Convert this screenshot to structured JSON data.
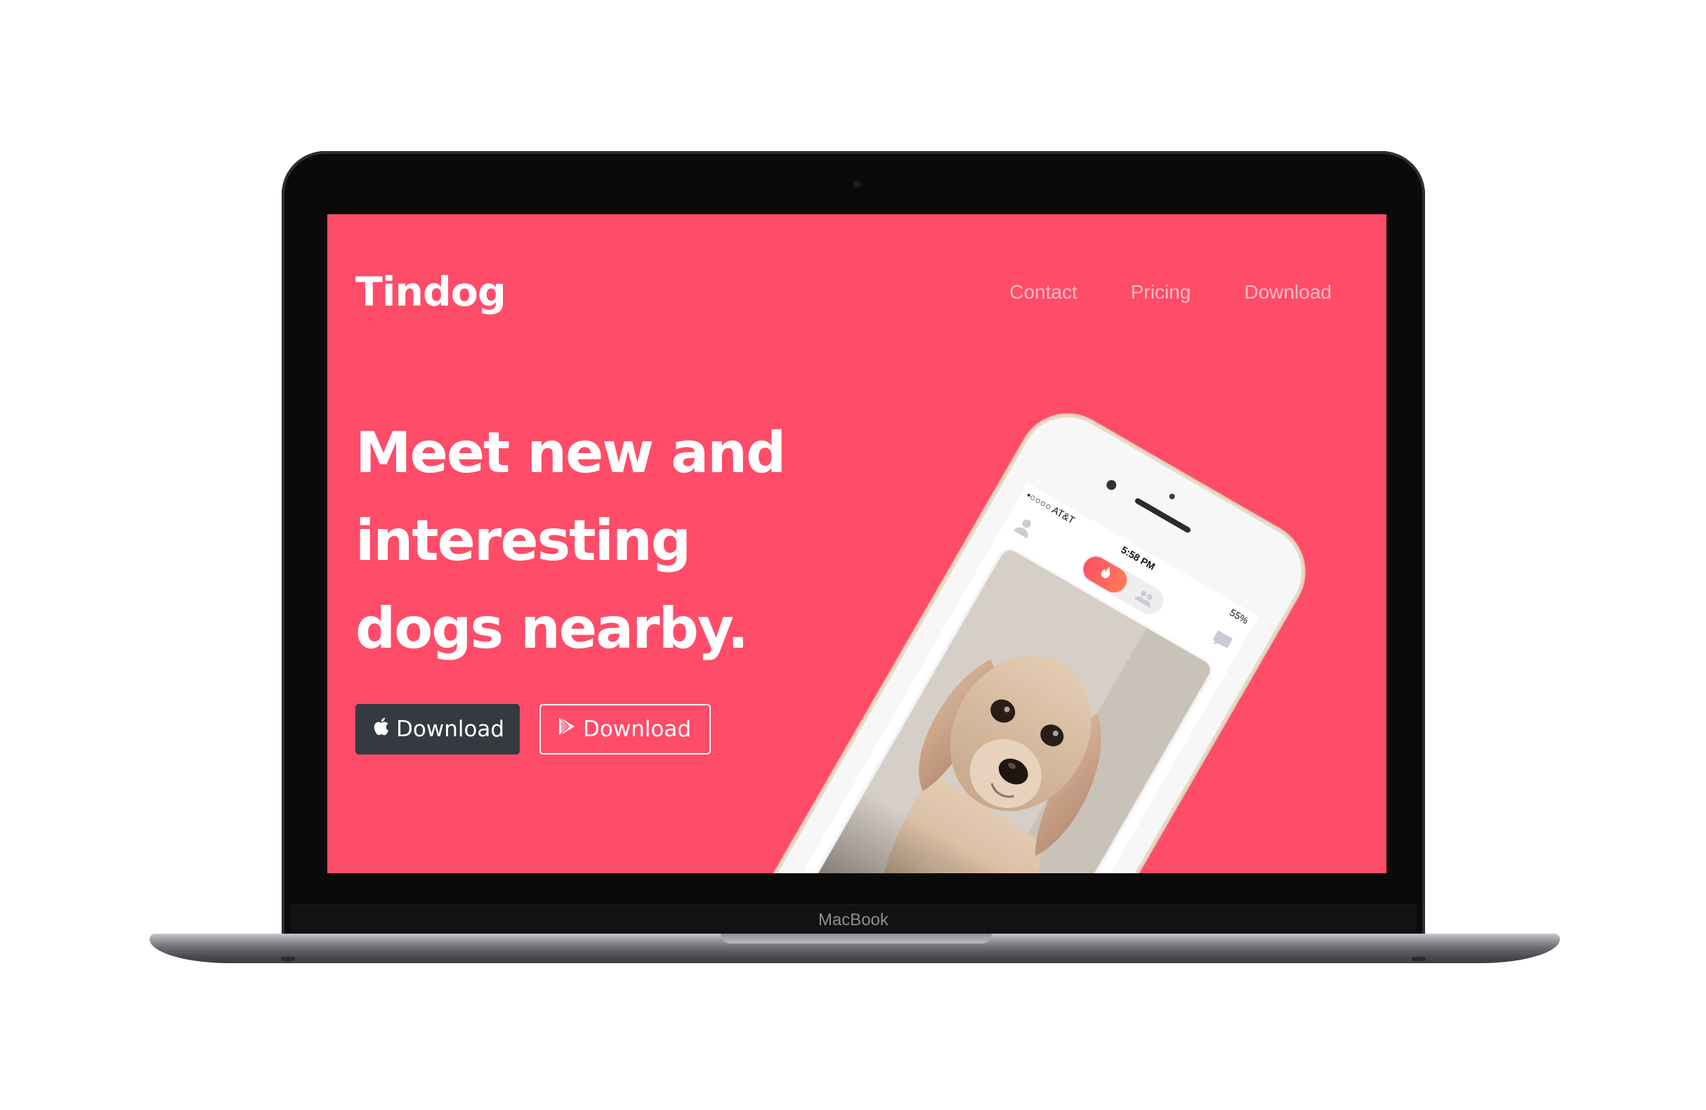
{
  "device": {
    "brand_label": "MacBook"
  },
  "site": {
    "brand": "Tindog",
    "nav": [
      {
        "label": "Contact"
      },
      {
        "label": "Pricing"
      },
      {
        "label": "Download"
      }
    ],
    "headline": {
      "line1": "Meet new and",
      "line2": "interesting",
      "line3": "dogs nearby."
    },
    "buttons": {
      "apple_download": "Download",
      "play_download": "Download"
    }
  },
  "phone": {
    "carrier": "•○○○○ AT&T",
    "time": "5:58 PM",
    "battery": "55%"
  },
  "colors": {
    "hero_background": "#ff4c68",
    "dark_button": "#343a40",
    "text": "#ffffff"
  },
  "icons": [
    "apple-icon",
    "google-play-icon",
    "profile-icon",
    "flame-icon",
    "people-icon",
    "chat-icon"
  ]
}
